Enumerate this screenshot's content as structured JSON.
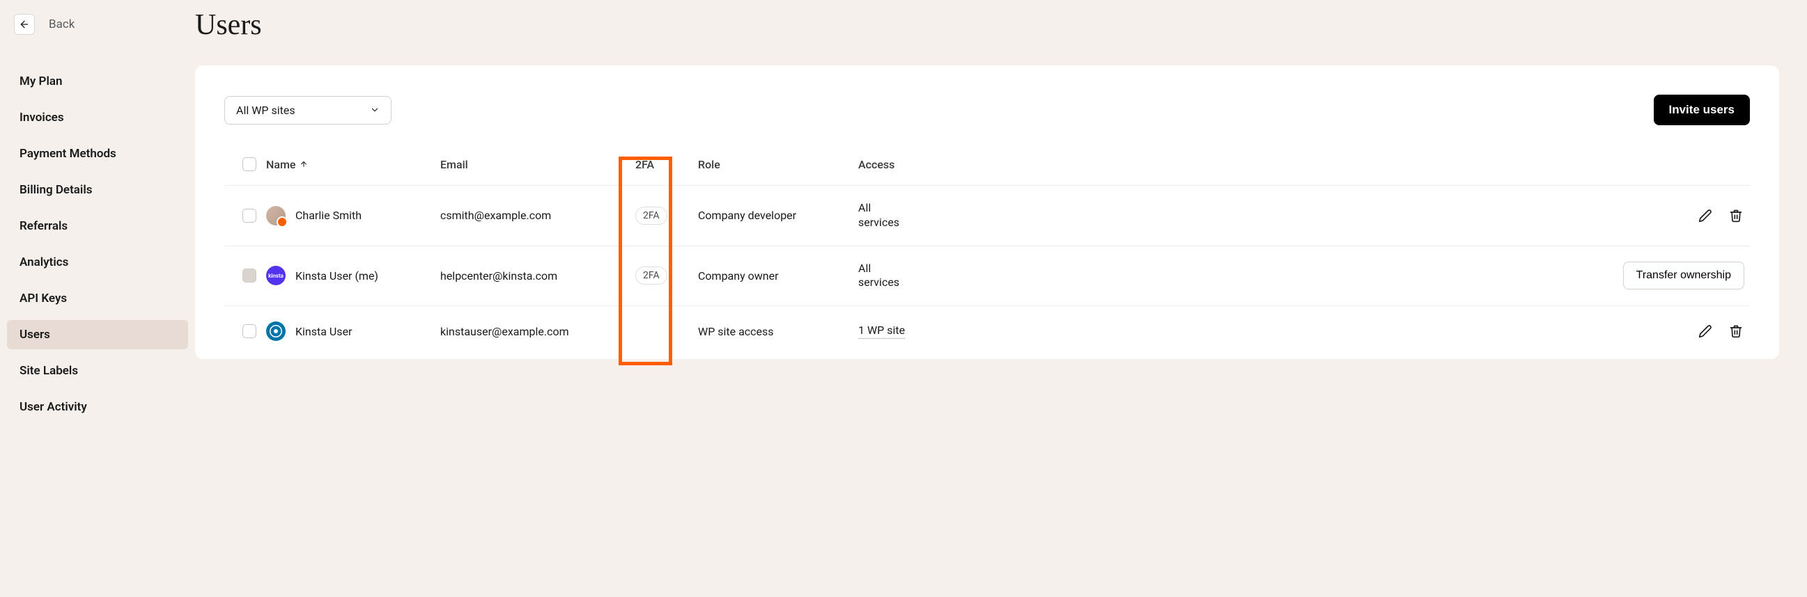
{
  "back_label": "Back",
  "page_title": "Users",
  "sidebar": {
    "items": [
      {
        "label": "My Plan"
      },
      {
        "label": "Invoices"
      },
      {
        "label": "Payment Methods"
      },
      {
        "label": "Billing Details"
      },
      {
        "label": "Referrals"
      },
      {
        "label": "Analytics"
      },
      {
        "label": "API Keys"
      },
      {
        "label": "Users"
      },
      {
        "label": "Site Labels"
      },
      {
        "label": "User Activity"
      }
    ],
    "active_index": 7
  },
  "filter": {
    "selected": "All WP sites"
  },
  "actions": {
    "invite_label": "Invite users",
    "transfer_label": "Transfer ownership"
  },
  "table": {
    "columns": {
      "name": "Name",
      "email": "Email",
      "twofa": "2FA",
      "role": "Role",
      "access": "Access"
    },
    "rows": [
      {
        "name": "Charlie Smith",
        "email": "csmith@example.com",
        "twofa": "2FA",
        "role": "Company developer",
        "access": "All services",
        "avatar_color": "#b39a87",
        "avatar_badge": true,
        "checkbox_disabled": false,
        "row_actions": "edit_delete"
      },
      {
        "name": "Kinsta User (me)",
        "email": "helpcenter@kinsta.com",
        "twofa": "2FA",
        "role": "Company owner",
        "access": "All services",
        "avatar_color": "#5333ed",
        "avatar_badge": false,
        "checkbox_disabled": true,
        "row_actions": "transfer"
      },
      {
        "name": "Kinsta User",
        "email": "kinstauser@example.com",
        "twofa": "",
        "role": "WP site access",
        "access": "1 WP site",
        "avatar_color": "#0073aa",
        "avatar_type": "wp",
        "avatar_badge": false,
        "checkbox_disabled": false,
        "row_actions": "edit_delete"
      }
    ]
  }
}
